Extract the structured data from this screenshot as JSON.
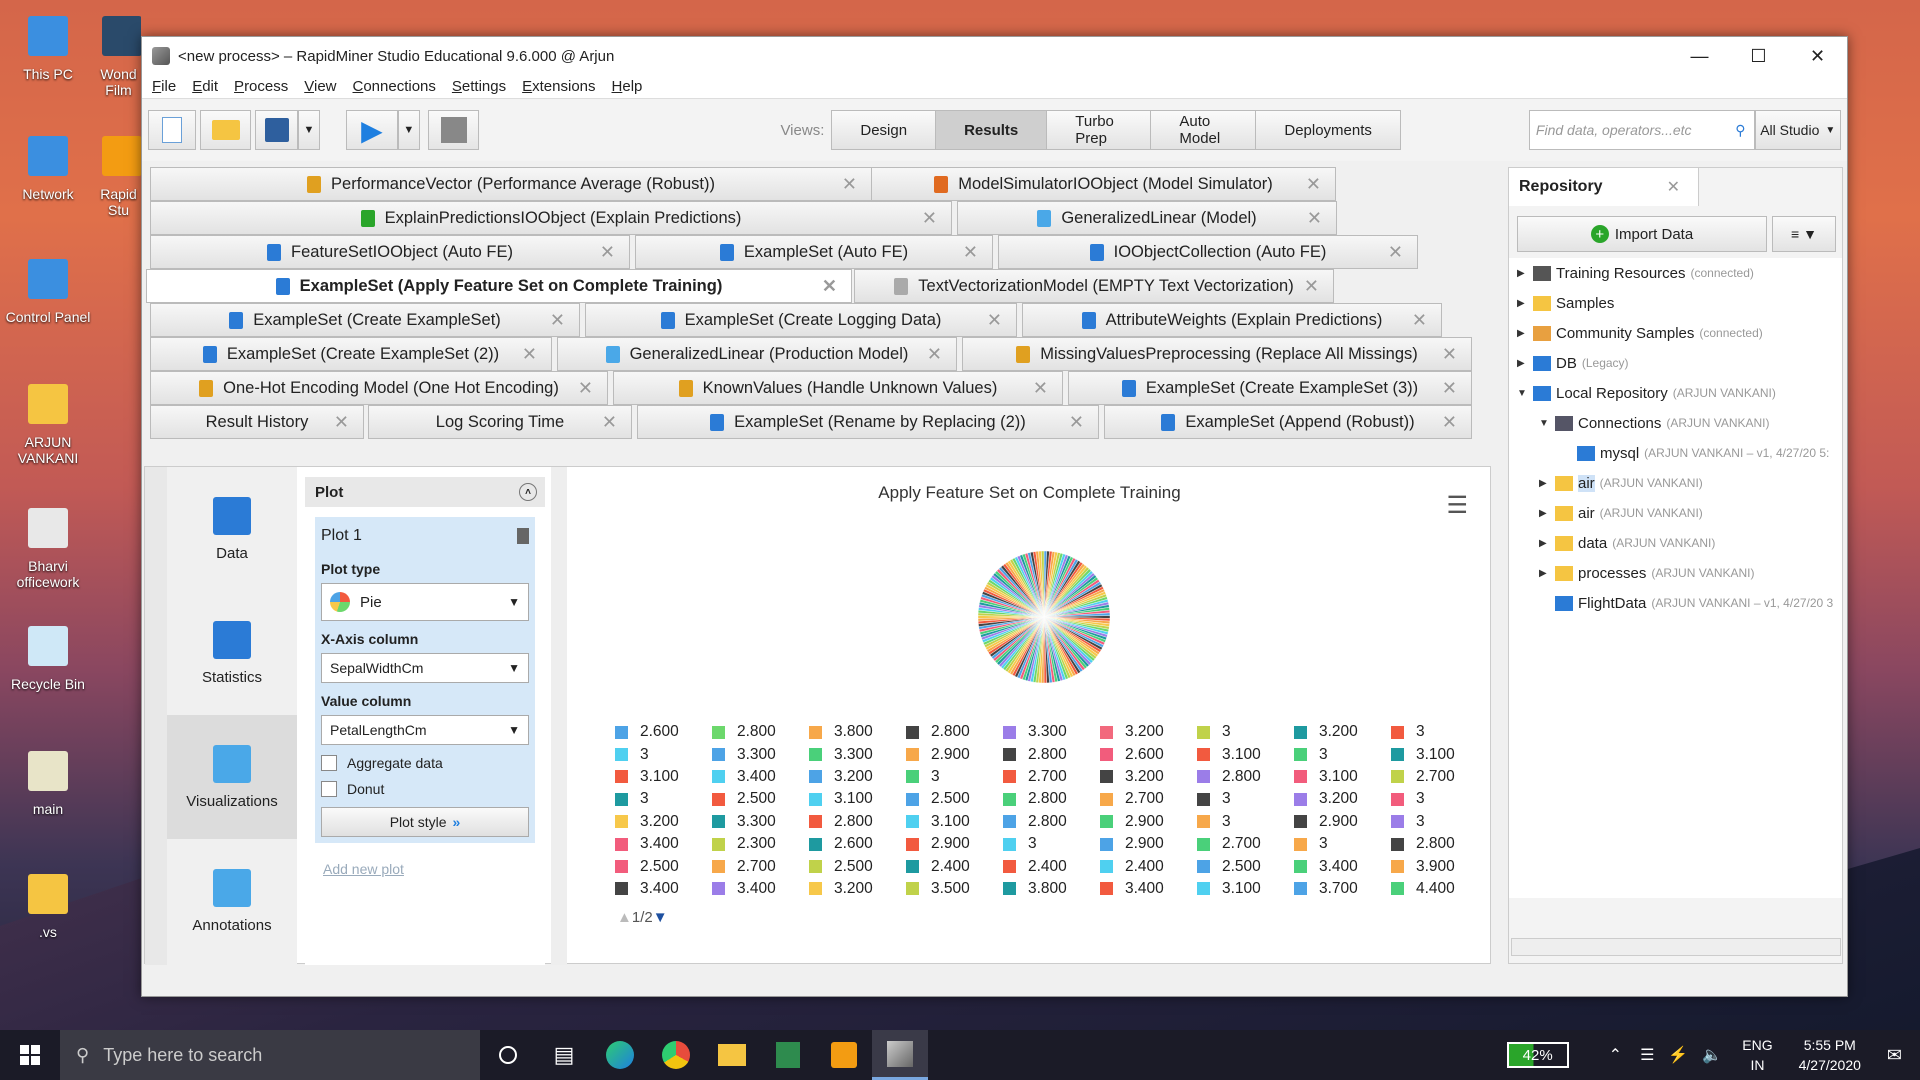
{
  "desktop": {
    "icons": [
      "This PC",
      "Network",
      "Control Panel",
      "ARJUN VANKANI",
      "Bharvi officework",
      "Recycle Bin",
      "main",
      ".vs"
    ],
    "partial": [
      "Wond Film",
      "Rapid Stu"
    ]
  },
  "window": {
    "title": "<new process> – RapidMiner Studio Educational 9.6.000 @ Arjun"
  },
  "menu": [
    "File",
    "Edit",
    "Process",
    "View",
    "Connections",
    "Settings",
    "Extensions",
    "Help"
  ],
  "views": {
    "label": "Views:",
    "items": [
      "Design",
      "Results",
      "Turbo Prep",
      "Auto Model",
      "Deployments"
    ],
    "active": "Results"
  },
  "search": {
    "placeholder": "Find data, operators...etc",
    "scope": "All Studio"
  },
  "tabs": [
    {
      "label": "PerformanceVector (Performance Average (Robust))"
    },
    {
      "label": "ModelSimulatorIOObject (Model Simulator)"
    },
    {
      "label": "ExplainPredictionsIOObject (Explain Predictions)"
    },
    {
      "label": "GeneralizedLinear (Model)"
    },
    {
      "label": "FeatureSetIOObject (Auto FE)"
    },
    {
      "label": "ExampleSet (Auto FE)"
    },
    {
      "label": "IOObjectCollection (Auto FE)"
    },
    {
      "label": "ExampleSet (Apply Feature Set on Complete Training)"
    },
    {
      "label": "TextVectorizationModel (EMPTY Text Vectorization)"
    },
    {
      "label": "ExampleSet (Create ExampleSet)"
    },
    {
      "label": "ExampleSet (Create Logging Data)"
    },
    {
      "label": "AttributeWeights (Explain Predictions)"
    },
    {
      "label": "ExampleSet (Create ExampleSet (2))"
    },
    {
      "label": "GeneralizedLinear (Production Model)"
    },
    {
      "label": "MissingValuesPreprocessing (Replace All Missings)"
    },
    {
      "label": "One-Hot Encoding Model (One Hot Encoding)"
    },
    {
      "label": "KnownValues (Handle Unknown Values)"
    },
    {
      "label": "ExampleSet (Create ExampleSet (3))"
    },
    {
      "label": "Result History"
    },
    {
      "label": "Log Scoring Time"
    },
    {
      "label": "ExampleSet (Rename by Replacing (2))"
    },
    {
      "label": "ExampleSet (Append (Robust))"
    }
  ],
  "nav": {
    "items": [
      "Data",
      "Statistics",
      "Visualizations",
      "Annotations"
    ],
    "active": "Visualizations"
  },
  "plot_panel": {
    "header": "Plot",
    "plot_name": "Plot 1",
    "plot_type_label": "Plot type",
    "plot_type": "Pie",
    "x_label": "X-Axis column",
    "x_value": "SepalWidthCm",
    "value_label": "Value column",
    "value_value": "PetalLengthCm",
    "aggregate": "Aggregate data",
    "donut": "Donut",
    "plot_style": "Plot style",
    "add_new": "Add new plot"
  },
  "chart_data": {
    "type": "pie",
    "title": "Apply Feature Set on Complete Training",
    "pager": "1/2",
    "legend_columns": [
      [
        "2.600",
        "3",
        "3.100",
        "3",
        "3.200",
        "3.400",
        "2.500",
        "3.400"
      ],
      [
        "2.800",
        "3.300",
        "3.400",
        "2.500",
        "3.300",
        "2.300",
        "2.700",
        "3.400"
      ],
      [
        "3.800",
        "3.300",
        "3.200",
        "3.100",
        "2.800",
        "2.600",
        "2.500",
        "3.200"
      ],
      [
        "2.800",
        "2.900",
        "3",
        "2.500",
        "3.100",
        "2.900",
        "2.400",
        "3.500"
      ],
      [
        "3.300",
        "2.800",
        "2.700",
        "2.800",
        "2.800",
        "3",
        "2.400",
        "3.800"
      ],
      [
        "3.200",
        "2.600",
        "3.200",
        "2.700",
        "2.900",
        "2.900",
        "2.400",
        "3.400"
      ],
      [
        "3",
        "3.100",
        "2.800",
        "3",
        "3",
        "2.700",
        "2.500",
        "3.100"
      ],
      [
        "3.200",
        "3",
        "3.100",
        "3.200",
        "2.900",
        "3",
        "3.400",
        "3.700"
      ],
      [
        "3",
        "3.100",
        "2.700",
        "3",
        "3",
        "2.800",
        "3.900",
        "4.400"
      ]
    ],
    "legend_colors": [
      [
        "#4da3e6",
        "#4fd0f0",
        "#f25a3f",
        "#1e9aa0",
        "#f7c84a",
        "#f25c7c",
        "#f25c7c",
        "#444"
      ],
      [
        "#6cd86c",
        "#4da3e6",
        "#4fd0f0",
        "#f25a3f",
        "#1e9aa0",
        "#c0d24a",
        "#f7a84a",
        "#9b7de8"
      ],
      [
        "#f7a84a",
        "#4ad07a",
        "#4da3e6",
        "#4fd0f0",
        "#f25a3f",
        "#1e9aa0",
        "#c0d24a",
        "#f7c84a"
      ],
      [
        "#444",
        "#f7a84a",
        "#4ad07a",
        "#4da3e6",
        "#4fd0f0",
        "#f25a3f",
        "#1e9aa0",
        "#c0d24a"
      ],
      [
        "#9b7de8",
        "#444",
        "#f25a3f",
        "#4ad07a",
        "#4da3e6",
        "#4fd0f0",
        "#f25a3f",
        "#1e9aa0"
      ],
      [
        "#f2697d",
        "#f25c7c",
        "#444",
        "#f7a84a",
        "#4ad07a",
        "#4da3e6",
        "#4fd0f0",
        "#f25a3f"
      ],
      [
        "#c0d24a",
        "#f25a3f",
        "#9b7de8",
        "#444",
        "#f7a84a",
        "#4ad07a",
        "#4da3e6",
        "#4fd0f0"
      ],
      [
        "#1e9aa0",
        "#4ad07a",
        "#f25c7c",
        "#9b7de8",
        "#444",
        "#f7a84a",
        "#4ad07a",
        "#4da3e6"
      ],
      [
        "#f25a3f",
        "#1e9aa0",
        "#c0d24a",
        "#f25c7c",
        "#9b7de8",
        "#444",
        "#f7a84a",
        "#4ad07a"
      ]
    ]
  },
  "repository": {
    "tab": "Repository",
    "import": "Import Data",
    "items": [
      {
        "label": "Training Resources",
        "meta": "(connected)",
        "indent": 0,
        "icon": "#555"
      },
      {
        "label": "Samples",
        "meta": "",
        "indent": 0,
        "icon": "#f5c542"
      },
      {
        "label": "Community Samples",
        "meta": "(connected)",
        "indent": 0,
        "icon": "#e8a040"
      },
      {
        "label": "DB",
        "meta": "(Legacy)",
        "indent": 0,
        "icon": "#2b7bd6"
      },
      {
        "label": "Local Repository",
        "meta": "(ARJUN VANKANI)",
        "indent": 0,
        "icon": "#2b7bd6"
      },
      {
        "label": "Connections",
        "meta": "(ARJUN VANKANI)",
        "indent": 1,
        "icon": "#556"
      },
      {
        "label": "mysql",
        "meta": "(ARJUN VANKANI – v1, 4/27/20 5:",
        "indent": 2,
        "icon": "#2b7bd6"
      },
      {
        "label": "air",
        "meta": "(ARJUN VANKANI)",
        "indent": 1,
        "icon": "#f5c542"
      },
      {
        "label": "air",
        "meta": "(ARJUN VANKANI)",
        "indent": 1,
        "icon": "#f5c542"
      },
      {
        "label": "data",
        "meta": "(ARJUN VANKANI)",
        "indent": 1,
        "icon": "#f5c542"
      },
      {
        "label": "processes",
        "meta": "(ARJUN VANKANI)",
        "indent": 1,
        "icon": "#f5c542"
      },
      {
        "label": "FlightData",
        "meta": "(ARJUN VANKANI – v1, 4/27/20 3",
        "indent": 1,
        "icon": "#2b7bd6"
      }
    ]
  },
  "taskbar": {
    "search": "Type here to search",
    "battery": "42%",
    "lang": "ENG",
    "region": "IN",
    "time": "5:55 PM",
    "date": "4/27/2020"
  }
}
